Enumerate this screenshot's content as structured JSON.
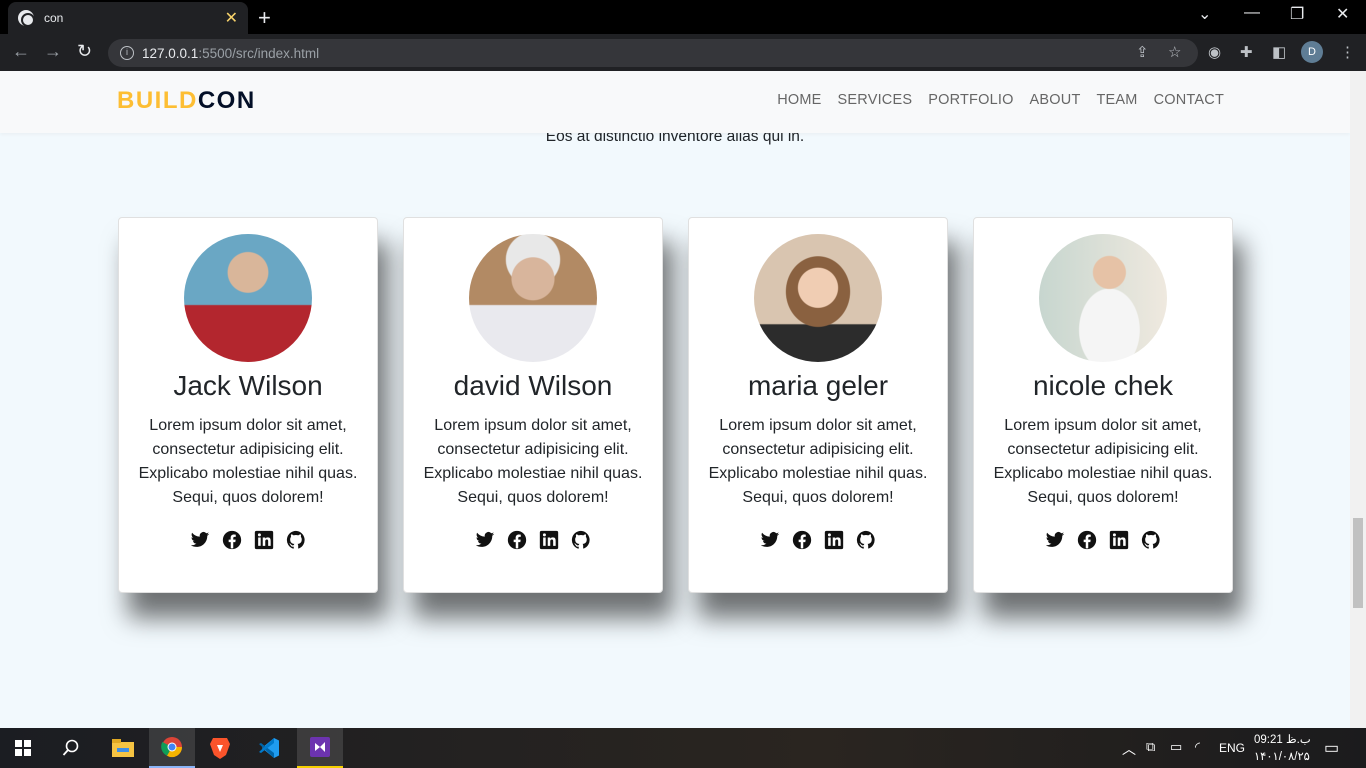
{
  "browser": {
    "tab_title": "con",
    "url_host": "127.0.0.1",
    "url_rest": ":5500/src/index.html",
    "profile_initial": "D"
  },
  "site": {
    "logo_part1": "BUILD",
    "logo_part2": "CON",
    "nav": [
      "HOME",
      "SERVICES",
      "PORTFOLIO",
      "ABOUT",
      "TEAM",
      "CONTACT"
    ],
    "section_subtitle": "Eos at distinctio inventore alias qui in."
  },
  "team": [
    {
      "name": "Jack Wilson",
      "bio": "Lorem ipsum dolor sit amet, consectetur adipisicing elit. Explicabo molestiae nihil quas. Sequi, quos dolorem!"
    },
    {
      "name": "david Wilson",
      "bio": "Lorem ipsum dolor sit amet, consectetur adipisicing elit. Explicabo molestiae nihil quas. Sequi, quos dolorem!"
    },
    {
      "name": "maria geler",
      "bio": "Lorem ipsum dolor sit amet, consectetur adipisicing elit. Explicabo molestiae nihil quas. Sequi, quos dolorem!"
    },
    {
      "name": "nicole chek",
      "bio": "Lorem ipsum dolor sit amet, consectetur adipisicing elit. Explicabo molestiae nihil quas. Sequi, quos dolorem!"
    }
  ],
  "social_icons": [
    "twitter-icon",
    "facebook-icon",
    "linkedin-icon",
    "github-icon"
  ],
  "taskbar": {
    "lang": "ENG",
    "time": "09:21 ب.ظ",
    "date": "۱۴۰۱/۰۸/۲۵"
  },
  "colors": {
    "logo_accent": "#fdbe33",
    "logo_dark": "#030f27",
    "page_bg": "#f2f9fd"
  }
}
